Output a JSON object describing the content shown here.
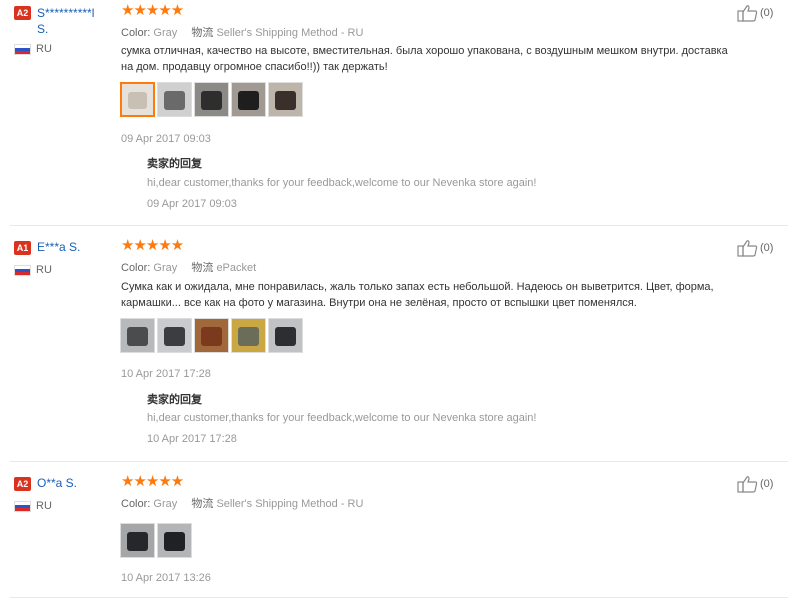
{
  "reviews": [
    {
      "badge": "A2",
      "user": "S**********l S.",
      "user_line1": "S**********l",
      "user_line2": "S.",
      "country": "RU",
      "rating": "★★★★★",
      "color_label": "Color:",
      "color_value": "Gray",
      "shipping_label": "物流",
      "shipping_value": "Seller's Shipping Method - RU",
      "text_line1": "сумка отличная, качество на высоте, вместительная. была хорошо упакована, с воздушным мешком внутри. доставка",
      "text_line2": "на дом. продавцу огромное спасибо!!)) так держать!",
      "thumbnails": [
        {
          "shape_color": "#c9c0b5",
          "bg": "#e6e1da"
        },
        {
          "shape_color": "#6a6a6a",
          "bg": "#d0d0d0"
        },
        {
          "shape_color": "#2e2e2e",
          "bg": "#8c8a86"
        },
        {
          "shape_color": "#1e1e1e",
          "bg": "#a19a93"
        },
        {
          "shape_color": "#3a2f2a",
          "bg": "#bdb5aa"
        }
      ],
      "date": "09 Apr 2017 09:03",
      "reply_title": "卖家的回复",
      "reply_text": "hi,dear customer,thanks for your feedback,welcome to our Nevenka store again!",
      "reply_date": "09 Apr 2017 09:03",
      "likes": "(0)"
    },
    {
      "badge": "A1",
      "user": "E***a S.",
      "country": "RU",
      "rating": "★★★★★",
      "color_label": "Color:",
      "color_value": "Gray",
      "shipping_label": "物流",
      "shipping_value": "ePacket",
      "text_line1": "Сумка как и ожидала, мне понравилась, жаль только запах есть небольшой. Надеюсь он выветрится. Цвет, форма,",
      "text_line2": "кармашки... все как на фото у магазина. Внутри она не зелёная, просто от вспышки цвет поменялся.",
      "thumbnails": [
        {
          "shape_color": "#4a4c4e",
          "bg": "#b7b9bb"
        },
        {
          "shape_color": "#3b3d40",
          "bg": "#c9cbcd"
        },
        {
          "shape_color": "#7b3a1e",
          "bg": "#a0683b"
        },
        {
          "shape_color": "#6a6d58",
          "bg": "#c9a743"
        },
        {
          "shape_color": "#2c2e31",
          "bg": "#c0c2c4"
        }
      ],
      "date": "10 Apr 2017 17:28",
      "reply_title": "卖家的回复",
      "reply_text": "hi,dear customer,thanks for your feedback,welcome to our Nevenka store again!",
      "reply_date": "10 Apr 2017 17:28",
      "likes": "(0)"
    },
    {
      "badge": "A2",
      "user": "O**a S.",
      "country": "RU",
      "rating": "★★★★★",
      "color_label": "Color:",
      "color_value": "Gray",
      "shipping_label": "物流",
      "shipping_value": "Seller's Shipping Method - RU",
      "thumbnails": [
        {
          "shape_color": "#25272a",
          "bg": "#a4a6a8"
        },
        {
          "shape_color": "#1f2124",
          "bg": "#b3b5b7"
        }
      ],
      "date": "10 Apr 2017 13:26",
      "likes": "(0)"
    }
  ],
  "colors": {
    "badge_bg": "#d9321f",
    "username": "#1a5fb4",
    "star": "#ff7a0d",
    "muted": "#999999",
    "thumb_active_border": "#ff7a0d"
  },
  "icons": {
    "like": "thumbs-up-icon",
    "flag": "russia-flag-icon",
    "star": "star-icon"
  }
}
